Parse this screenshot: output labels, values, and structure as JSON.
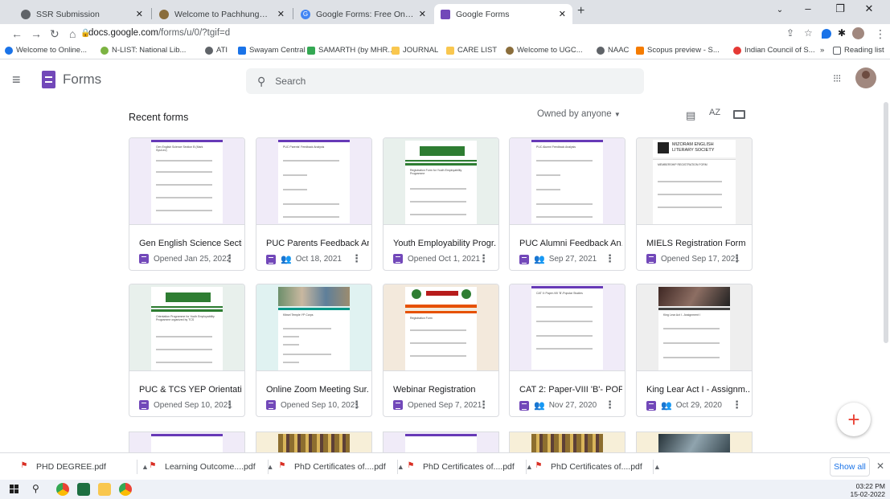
{
  "browser": {
    "tabs": [
      {
        "label": "SSR Submission",
        "color": "#5f6368"
      },
      {
        "label": "Welcome to Pachhunga Universi",
        "color": "#8a6d3b"
      },
      {
        "label": "Google Forms: Free Online Form",
        "color": "#4285f4"
      },
      {
        "label": "Google Forms",
        "color": "#7248b9"
      }
    ],
    "new_tab": "+",
    "url_host": "docs.google.com",
    "url_path": "/forms/u/0/?tgif=d",
    "bookmarks": [
      {
        "label": "Welcome to Online...",
        "color": "#1a73e8"
      },
      {
        "label": "N-LIST: National Lib...",
        "color": "#7cb342"
      },
      {
        "label": "ATI",
        "color": "#5f6368"
      },
      {
        "label": "Swayam Central",
        "color": "#1a73e8"
      },
      {
        "label": "SAMARTH (by MHR...",
        "color": "#34a853"
      },
      {
        "label": "JOURNAL",
        "color": "#f9c74f"
      },
      {
        "label": "CARE LIST",
        "color": "#f9c74f"
      },
      {
        "label": "Welcome to UGC...",
        "color": "#8a6d3b"
      },
      {
        "label": "NAAC",
        "color": "#5f6368"
      },
      {
        "label": "Scopus preview - S...",
        "color": "#f57c00"
      },
      {
        "label": "Indian Council of S...",
        "color": "#e53935"
      }
    ],
    "bookmarks_more": "»",
    "reading_list": "Reading list"
  },
  "app": {
    "name": "Forms",
    "search_placeholder": "Search"
  },
  "recent": {
    "title": "Recent forms",
    "owner_filter": "Owned by anyone"
  },
  "forms": [
    {
      "title": "Gen English Science Secti...",
      "meta": "Opened Jan 25, 2022",
      "shared": false,
      "thumb": "plain",
      "doc_title": "Gen English Science Section B (Mark Sys/Lev)"
    },
    {
      "title": "PUC Parents Feedback An...",
      "meta": "Oct 18, 2021",
      "shared": true,
      "thumb": "plain",
      "doc_title": "PUC Parents' Feedback Analysis"
    },
    {
      "title": "Youth Employability Progr...",
      "meta": "Opened Oct 1, 2021",
      "shared": false,
      "thumb": "college",
      "doc_title": "Registration Form for Youth Employability Programme"
    },
    {
      "title": "PUC Alumni Feedback An...",
      "meta": "Sep 27, 2021",
      "shared": true,
      "thumb": "plain",
      "doc_title": "PUC Alumni Feedback Analysis"
    },
    {
      "title": "MIELS Registration Form",
      "meta": "Opened Sep 17, 2021",
      "shared": false,
      "thumb": "miels",
      "doc_title": "MEMBERSHIP REGISTRATION FORM",
      "banner_text": "MIZORAM ENGLISH LITERARY SOCIETY"
    },
    {
      "title": "PUC & TCS YEP Orientatio...",
      "meta": "Opened Sep 10, 2021",
      "shared": false,
      "thumb": "college",
      "doc_title": "Orientation Programme for Youth Employability Programme organized by TCS"
    },
    {
      "title": "Online Zoom Meeting Sur...",
      "meta": "Opened Sep 10, 2021",
      "shared": false,
      "thumb": "photo",
      "doc_title": "Kibsel Temple YP Corps"
    },
    {
      "title": "Webinar Registration",
      "meta": "Opened Sep 7, 2021",
      "shared": false,
      "thumb": "webinar",
      "doc_title": "Registration Form"
    },
    {
      "title": "CAT 2: Paper-VIII 'B'- POP...",
      "meta": "Nov 27, 2020",
      "shared": true,
      "thumb": "plain",
      "doc_title": "CAT II: Paper-VIII 'B'-Popular Studies"
    },
    {
      "title": "King Lear Act I - Assignm...",
      "meta": "Oct 29, 2020",
      "shared": true,
      "thumb": "dark",
      "doc_title": "King Lear Act I - Assignment I"
    }
  ],
  "downloads": [
    {
      "name": "PHD DEGREE.pdf"
    },
    {
      "name": "Learning Outcome....pdf"
    },
    {
      "name": "PhD Certificates of....pdf"
    },
    {
      "name": "PhD Certificates of....pdf"
    },
    {
      "name": "PhD Certificates of....pdf"
    }
  ],
  "downloads_show_all": "Show all",
  "taskbar": {
    "time": "03:22 PM",
    "date": "15-02-2022"
  },
  "colors": {
    "forms_purple": "#7248b9",
    "accent_blue": "#1a73e8"
  }
}
